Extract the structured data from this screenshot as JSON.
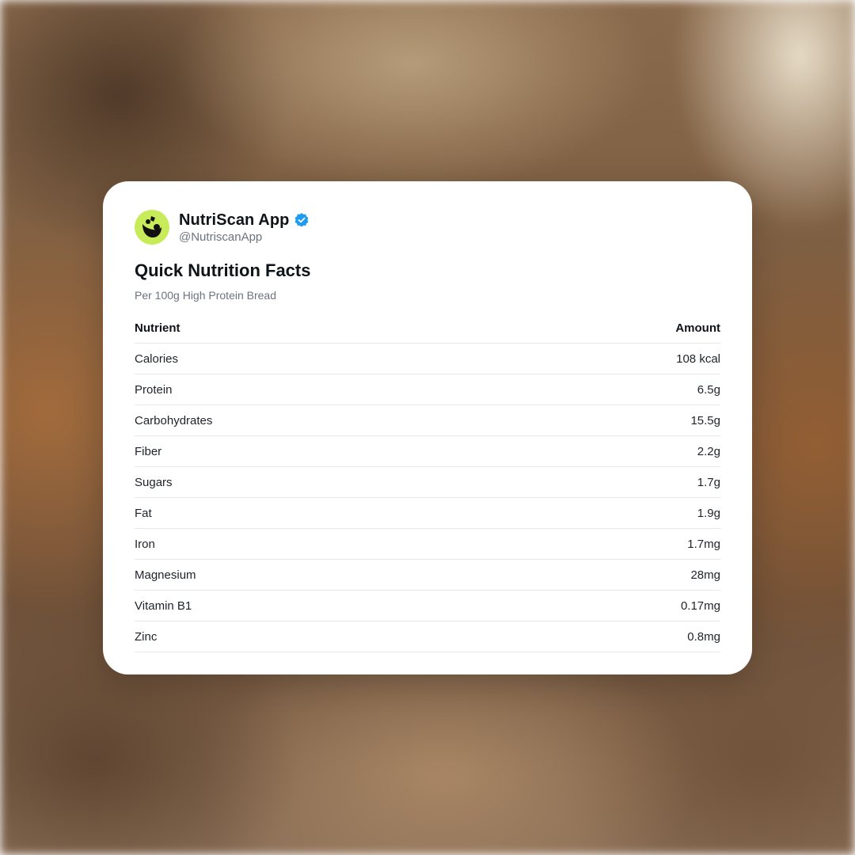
{
  "profile": {
    "name": "NutriScan App",
    "handle": "@NutriscanApp",
    "avatar_icon": "leaf-bowl-icon",
    "verified_icon": "verified-badge-icon",
    "colors": {
      "avatar_bg": "#c8eb5a",
      "verified": "#1d9bf0"
    }
  },
  "card": {
    "title": "Quick Nutrition Facts",
    "subtitle": "Per 100g High Protein Bread"
  },
  "table": {
    "headers": {
      "nutrient": "Nutrient",
      "amount": "Amount"
    },
    "rows": [
      {
        "nutrient": "Calories",
        "amount": "108 kcal"
      },
      {
        "nutrient": "Protein",
        "amount": "6.5g"
      },
      {
        "nutrient": "Carbohydrates",
        "amount": "15.5g"
      },
      {
        "nutrient": "Fiber",
        "amount": "2.2g"
      },
      {
        "nutrient": "Sugars",
        "amount": "1.7g"
      },
      {
        "nutrient": "Fat",
        "amount": "1.9g"
      },
      {
        "nutrient": "Iron",
        "amount": "1.7mg"
      },
      {
        "nutrient": "Magnesium",
        "amount": "28mg"
      },
      {
        "nutrient": "Vitamin B1",
        "amount": "0.17mg"
      },
      {
        "nutrient": "Zinc",
        "amount": "0.8mg"
      }
    ]
  }
}
